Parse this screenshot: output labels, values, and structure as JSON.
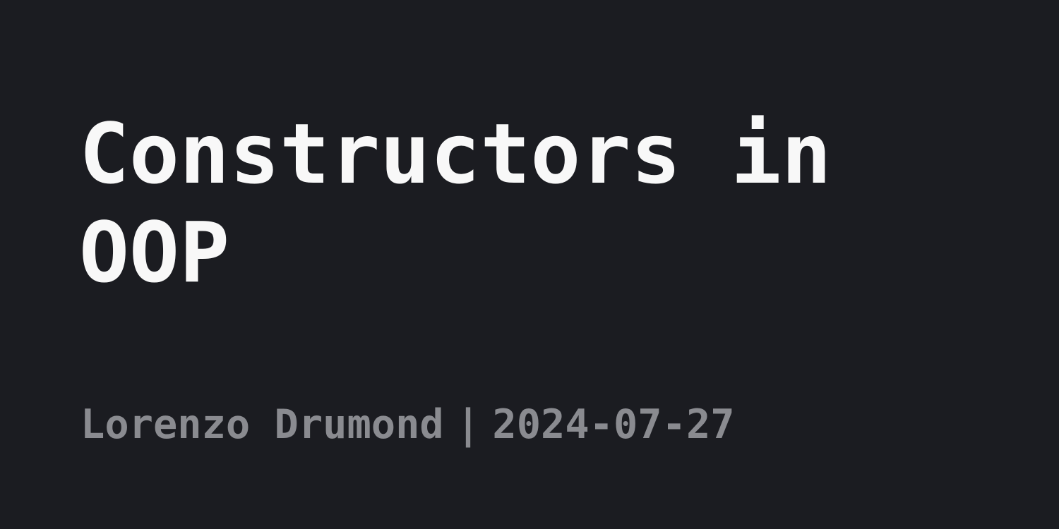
{
  "post": {
    "title": "Constructors in OOP",
    "author": "Lorenzo Drumond",
    "separator": "|",
    "date": "2024-07-27"
  },
  "colors": {
    "background": "#1b1c21",
    "title": "#f8f8f8",
    "meta": "#8a8b90"
  }
}
